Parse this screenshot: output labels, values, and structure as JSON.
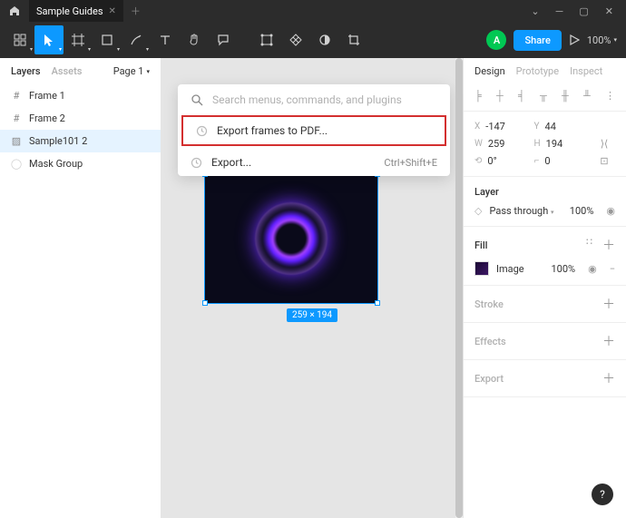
{
  "titlebar": {
    "tab_name": "Sample Guides"
  },
  "toolbar": {
    "avatar_letter": "A",
    "share_label": "Share",
    "zoom_label": "100%"
  },
  "left": {
    "tab_layers": "Layers",
    "tab_assets": "Assets",
    "page_label": "Page 1",
    "items": [
      {
        "label": "Frame 1",
        "icon": "frame"
      },
      {
        "label": "Frame 2",
        "icon": "frame"
      },
      {
        "label": "Sample101 2",
        "icon": "image",
        "selected": true
      },
      {
        "label": "Mask Group",
        "icon": "mask"
      }
    ]
  },
  "canvas": {
    "dim_label": "259 × 194"
  },
  "palette": {
    "placeholder": "Search menus, commands, and plugins",
    "items": [
      {
        "label": "Export frames to PDF...",
        "shortcut": "",
        "highlight": true
      },
      {
        "label": "Export...",
        "shortcut": "Ctrl+Shift+E"
      }
    ]
  },
  "right": {
    "tab_design": "Design",
    "tab_prototype": "Prototype",
    "tab_inspect": "Inspect",
    "x_lbl": "X",
    "x_val": "-147",
    "y_lbl": "Y",
    "y_val": "44",
    "w_lbl": "W",
    "w_val": "259",
    "h_lbl": "H",
    "h_val": "194",
    "rot_val": "0°",
    "rad_val": "0",
    "layer_title": "Layer",
    "blend_label": "Pass through",
    "opacity": "100%",
    "fill_title": "Fill",
    "fill_type": "Image",
    "fill_opacity": "100%",
    "stroke_title": "Stroke",
    "effects_title": "Effects",
    "export_title": "Export"
  }
}
